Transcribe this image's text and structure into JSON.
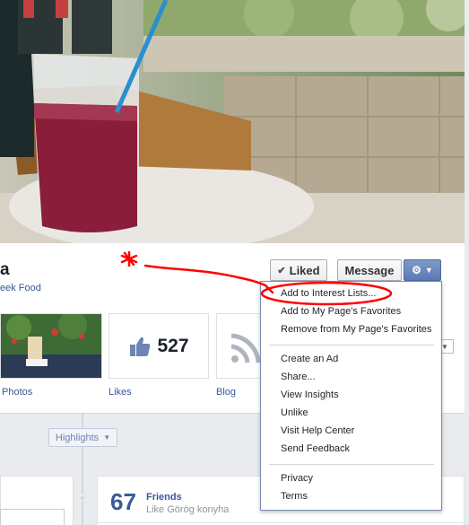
{
  "page": {
    "name": "a",
    "category": "eek Food"
  },
  "buttons": {
    "liked": "Liked",
    "liked_icon": "check-icon",
    "message": "Message",
    "gear_icon": "gear-icon"
  },
  "tiles": {
    "photos_label": "Photos",
    "likes_label": "Likes",
    "likes_count": "527",
    "blog_label": "Blog"
  },
  "timeline": {
    "highlights": "Highlights"
  },
  "friends": {
    "count": "67",
    "title": "Friends",
    "subtitle": "Like Görög konyha"
  },
  "menu": {
    "items": [
      "Add to Interest Lists...",
      "Add to My Page's Favorites",
      "Remove from My Page's Favorites",
      "Create an Ad",
      "Share...",
      "View Insights",
      "Unlike",
      "Visit Help Center",
      "Send Feedback",
      "Privacy",
      "Terms"
    ]
  },
  "annotation": {
    "color": "#ff0000",
    "mark": "*"
  },
  "colors": {
    "link": "#365899",
    "brand": "#3b5998"
  }
}
